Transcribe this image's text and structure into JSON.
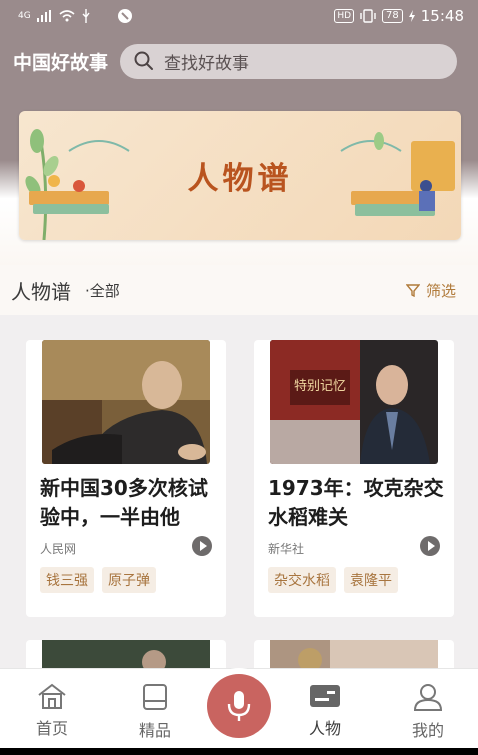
{
  "status_bar": {
    "network": "4G",
    "hd": "HD",
    "battery": "78",
    "time": "15:48"
  },
  "header": {
    "app_title": "中国好故事",
    "search_placeholder": "查找好故事"
  },
  "banner": {
    "title": "人物谱"
  },
  "section": {
    "title": "人物谱",
    "subtitle": "·全部",
    "filter_label": "筛选"
  },
  "cards": [
    {
      "title": "新中国30多次核试验中，一半由他",
      "source": "人民网",
      "tags": [
        "钱三强",
        "原子弹"
      ]
    },
    {
      "title": "1973年：攻克杂交水稻难关",
      "source": "新华社",
      "tags": [
        "杂交水稻",
        "袁隆平"
      ],
      "image_caption": "特别记忆"
    }
  ],
  "tabbar": {
    "items": [
      {
        "label": "首页",
        "icon": "home-icon"
      },
      {
        "label": "精品",
        "icon": "book-icon"
      },
      {
        "label": "人物",
        "icon": "card-icon",
        "active": true
      },
      {
        "label": "我的",
        "icon": "user-icon"
      }
    ],
    "mic_icon": "mic-icon"
  },
  "colors": {
    "header_bg": "#9a8b8c",
    "accent": "#b07a3a",
    "mic": "#c96460"
  }
}
